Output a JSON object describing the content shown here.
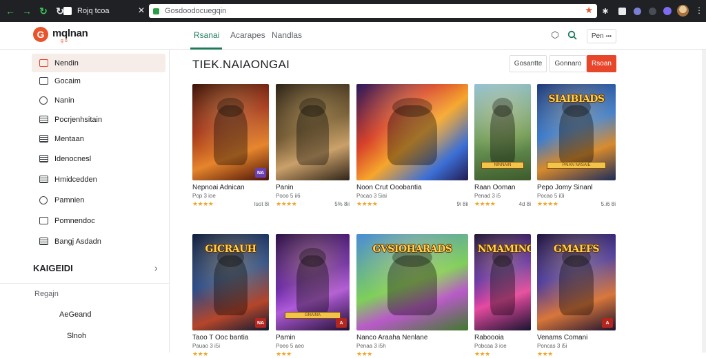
{
  "browser": {
    "tab_title": "Rojq tcoa",
    "url": "Gosdoodocuegqin",
    "icons": [
      "back-icon",
      "forward-icon",
      "reload-icon",
      "star-icon",
      "extension-icon",
      "avatar"
    ]
  },
  "header": {
    "logo_letter": "G",
    "logo_text": "mqlnan",
    "logo_sub": "g o",
    "tabs": [
      {
        "label": "Rsanai",
        "active": true
      },
      {
        "label": "Acarapes",
        "active": false
      },
      {
        "label": "Nandlas",
        "active": false
      }
    ],
    "button_label": "Pen",
    "colors": {
      "accent": "#1e7b5a",
      "brand": "#e8542b"
    }
  },
  "sidebar": {
    "items": [
      {
        "label": "Nendin",
        "icon": "box-icon",
        "active": true
      },
      {
        "label": "Gocaim",
        "icon": "square-icon",
        "active": false
      },
      {
        "label": "Nanin",
        "icon": "circle-icon",
        "active": false
      },
      {
        "label": "Pocrjenhsitain",
        "icon": "list-icon",
        "active": false
      },
      {
        "label": "Mentaan",
        "icon": "list-icon",
        "active": false
      },
      {
        "label": "Idenocnesl",
        "icon": "grid-icon",
        "active": false
      },
      {
        "label": "Hmidcedden",
        "icon": "grid-icon",
        "active": false
      },
      {
        "label": "Pamnien",
        "icon": "clock-icon",
        "active": false
      },
      {
        "label": "Pomnendoc",
        "icon": "square-icon",
        "active": false
      },
      {
        "label": "Bangj Asdadn",
        "icon": "book-icon",
        "active": false
      }
    ],
    "section_title": "KAIGEIDI",
    "section_label": "Regajn",
    "sub_items": [
      "AeGeand",
      "Slnoh"
    ]
  },
  "main": {
    "title": "TIEK.NAIAONGAI",
    "buttons": [
      {
        "label": "Gosantte",
        "primary": false
      },
      {
        "label": "Gonnaro",
        "primary": false
      },
      {
        "label": "Rsoan",
        "primary": true
      }
    ],
    "cards": [
      {
        "name": "Nepnoai Adnican",
        "sub": "Pop 3 ioe",
        "size": "Isot 8i",
        "stars": "★★★★",
        "banner": "",
        "badge": "NA",
        "badge_purple": true,
        "palette": "red"
      },
      {
        "name": "Panin",
        "sub": "Pooo 5 ii6",
        "size": "5% 8ii",
        "stars": "★★★★",
        "banner": "",
        "badge": "",
        "badge_purple": false,
        "palette": "bronze"
      },
      {
        "name": "Noon Crut Ooobantia",
        "sub": "Pocao 3 5iai",
        "size": "9i 8ii",
        "stars": "★★★★",
        "banner": "",
        "badge": "",
        "badge_purple": false,
        "palette": "fire"
      },
      {
        "name": "Raan Ooman",
        "sub": "Penad 3 i5",
        "size": "4d 8i",
        "stars": "★★★★",
        "banner": "",
        "badge": "",
        "badge_purple": false,
        "palette": "green",
        "plate": "NINNAIN"
      },
      {
        "name": "Pepo Jomy Sinanl",
        "sub": "Pocao 5 i0i",
        "size": "5.i6 8i",
        "stars": "★★★★",
        "banner": "SIAIBIADS",
        "badge": "",
        "badge_purple": false,
        "palette": "blue",
        "plate": "PAIAN NASAIE"
      },
      {
        "name": "Taoo T Ooc bantia",
        "sub": "Pauao 3 i5i",
        "size": "",
        "stars": "★★★",
        "banner": "GICRAUH",
        "badge": "NA",
        "badge_purple": false,
        "palette": "night"
      },
      {
        "name": "Pamin",
        "sub": "Poeo 5 aeo",
        "size": "",
        "stars": "★★★",
        "banner": "",
        "badge": "A",
        "badge_purple": false,
        "palette": "purple",
        "plate": "GNAINA"
      },
      {
        "name": "Nanco Araaha Nenlane",
        "sub": "Penaa 3 i5h",
        "size": "",
        "stars": "★★★",
        "banner": "GVSIOHARADS",
        "badge": "",
        "badge_purple": false,
        "palette": "meadow"
      },
      {
        "name": "Raboooia",
        "sub": "Pobcaa 3 ioe",
        "size": "",
        "stars": "★★★",
        "banner": "NMAMINC",
        "badge": "",
        "badge_purple": false,
        "palette": "neon"
      },
      {
        "name": "Venams Comani",
        "sub": "Poncas 3 i5i",
        "size": "",
        "stars": "★★★",
        "banner": "GMAEFS",
        "badge": "A",
        "badge_purple": false,
        "palette": "violet"
      }
    ]
  }
}
